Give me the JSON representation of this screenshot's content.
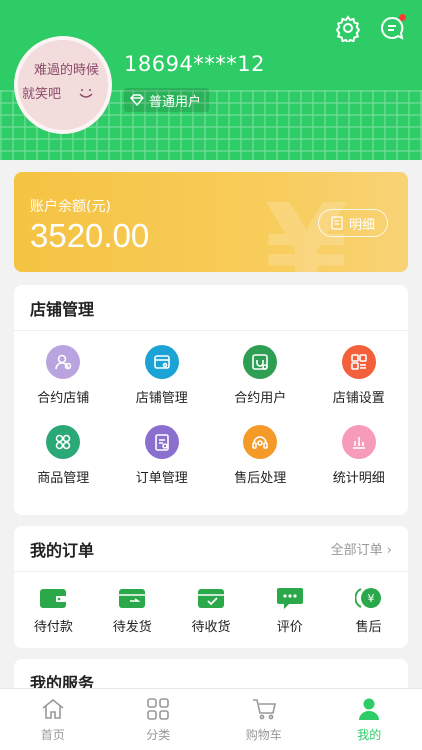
{
  "profile": {
    "phone": "18694****12",
    "level": "普通用户",
    "avatar_note_line1": "难過的時候",
    "avatar_note_line2": "就笑吧"
  },
  "header_icons": [
    "settings-icon",
    "message-icon"
  ],
  "balance": {
    "label": "账户余额(元)",
    "amount": "3520.00",
    "detail_button": "明细"
  },
  "store": {
    "title": "店铺管理",
    "items": [
      {
        "label": "合约店铺",
        "icon": "contract-store-icon",
        "color": "#b9a4e0"
      },
      {
        "label": "店铺管理",
        "icon": "store-manage-icon",
        "color": "#1aa3d4"
      },
      {
        "label": "合约用户",
        "icon": "contract-user-icon",
        "color": "#2e9e52"
      },
      {
        "label": "店铺设置",
        "icon": "store-settings-icon",
        "color": "#f2603c"
      },
      {
        "label": "商品管理",
        "icon": "goods-manage-icon",
        "color": "#2aa876"
      },
      {
        "label": "订单管理",
        "icon": "order-manage-icon",
        "color": "#8a6fcf"
      },
      {
        "label": "售后处理",
        "icon": "after-sales-icon",
        "color": "#f39a28"
      },
      {
        "label": "统计明细",
        "icon": "statistics-icon",
        "color": "#f79bbb"
      }
    ]
  },
  "orders": {
    "title": "我的订单",
    "more": "全部订单 ›",
    "items": [
      {
        "label": "待付款",
        "icon": "wallet-icon"
      },
      {
        "label": "待发货",
        "icon": "ship-icon"
      },
      {
        "label": "待收货",
        "icon": "receive-icon"
      },
      {
        "label": "评价",
        "icon": "comment-icon"
      },
      {
        "label": "售后",
        "icon": "refund-icon"
      }
    ]
  },
  "services": {
    "title": "我的服务"
  },
  "tabbar": {
    "items": [
      {
        "label": "首页",
        "icon": "home-icon"
      },
      {
        "label": "分类",
        "icon": "category-icon"
      },
      {
        "label": "购物车",
        "icon": "cart-icon"
      },
      {
        "label": "我的",
        "icon": "profile-icon",
        "active": true
      }
    ]
  },
  "colors": {
    "brand": "#2ecc66",
    "balance": "#f5c343"
  }
}
